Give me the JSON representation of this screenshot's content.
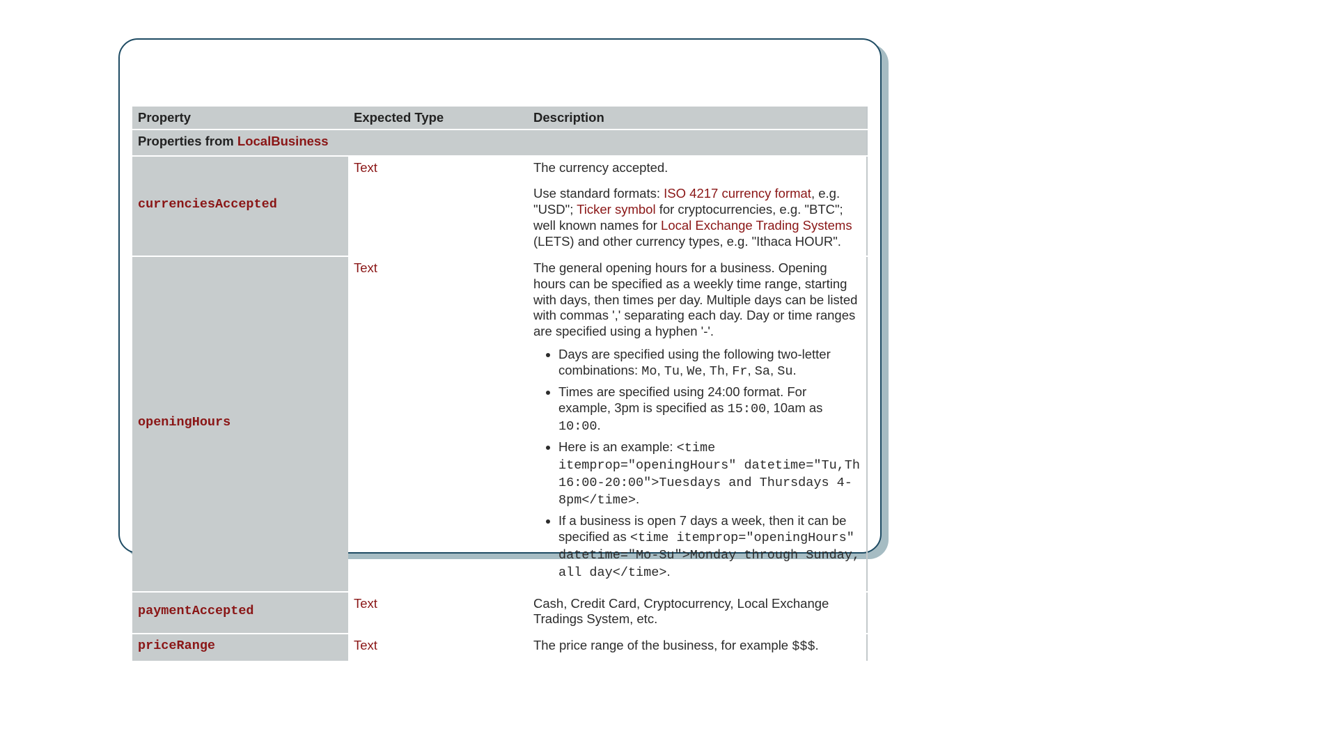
{
  "headers": {
    "property": "Property",
    "type": "Expected Type",
    "description": "Description"
  },
  "section": {
    "prefix": "Properties from ",
    "link": "LocalBusiness"
  },
  "rows": {
    "currenciesAccepted": {
      "name": "currenciesAccepted",
      "type": "Text",
      "desc_line1": "The currency accepted.",
      "desc_p2_a": "Use standard formats: ",
      "desc_p2_link1": "ISO 4217 currency format",
      "desc_p2_b": ", e.g. \"USD\"; ",
      "desc_p2_link2": "Ticker symbol",
      "desc_p2_c": " for cryptocurrencies, e.g. \"BTC\"; well known names for ",
      "desc_p2_link3": "Local Exchange Trading Systems",
      "desc_p2_d": " (LETS) and other currency types, e.g. \"Ithaca HOUR\"."
    },
    "openingHours": {
      "name": "openingHours",
      "type": "Text",
      "intro": "The general opening hours for a business. Opening hours can be specified as a weekly time range, starting with days, then times per day. Multiple days can be listed with commas ',' separating each day. Day or time ranges are specified using a hyphen '-'.",
      "li1_a": "Days are specified using the following two-letter combinations: ",
      "li1_code": "Mo",
      "li1_sep": ", ",
      "li1_c2": "Tu",
      "li1_c3": "We",
      "li1_c4": "Th",
      "li1_c5": "Fr",
      "li1_c6": "Sa",
      "li1_c7": "Su",
      "li1_end": ".",
      "li2_a": "Times are specified using 24:00 format. For example, 3pm is specified as ",
      "li2_code1": "15:00",
      "li2_mid": ", 10am as ",
      "li2_code2": "10:00",
      "li2_end": ".",
      "li3_a": "Here is an example: ",
      "li3_code": "<time itemprop=\"openingHours\" datetime=\"Tu,Th 16:00-20:00\">Tuesdays and Thursdays 4-8pm</time>",
      "li3_end": ".",
      "li4_a": "If a business is open 7 days a week, then it can be specified as ",
      "li4_code": "<time itemprop=\"openingHours\" datetime=\"Mo-Su\">Monday through Sunday, all day</time>",
      "li4_end": "."
    },
    "paymentAccepted": {
      "name": "paymentAccepted",
      "type": "Text",
      "desc": "Cash, Credit Card, Cryptocurrency, Local Exchange Tradings System, etc."
    },
    "priceRange": {
      "name": "priceRange",
      "type": "Text",
      "desc_a": "The price range of the business, for example ",
      "desc_code": "$$$",
      "desc_end": "."
    }
  }
}
